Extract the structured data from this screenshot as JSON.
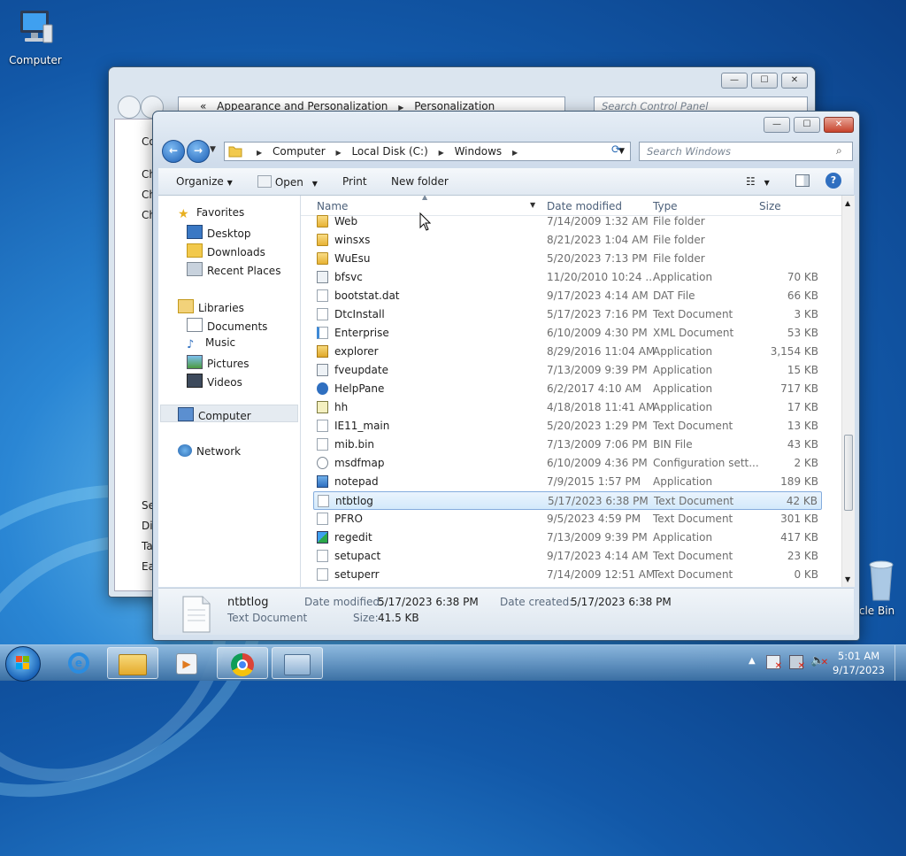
{
  "desktop": {
    "computer_label": "Computer",
    "recycle_label": "cle Bin"
  },
  "control_panel": {
    "breadcrumb_prefix": "«",
    "breadcrumb_1": "Appearance and Personalization",
    "breadcrumb_2": "Personalization",
    "search_placeholder": "Search Control Panel",
    "side_1": "Co",
    "side_2": "Ch",
    "side_3": "Ch",
    "side_4": "Ch",
    "side_5": "Se",
    "side_6": "Dis",
    "side_7": "Ta",
    "side_8": "Ea"
  },
  "explorer": {
    "breadcrumbs": [
      "Computer",
      "Local Disk (C:)",
      "Windows"
    ],
    "search_placeholder": "Search Windows",
    "toolbar": {
      "organize": "Organize",
      "open": "Open",
      "print": "Print",
      "new_folder": "New folder"
    },
    "nav": {
      "favorites": "Favorites",
      "desktop": "Desktop",
      "downloads": "Downloads",
      "recent": "Recent Places",
      "libraries": "Libraries",
      "documents": "Documents",
      "music": "Music",
      "pictures": "Pictures",
      "videos": "Videos",
      "computer": "Computer",
      "network": "Network"
    },
    "columns": {
      "name": "Name",
      "date": "Date modified",
      "type": "Type",
      "size": "Size"
    },
    "files": [
      {
        "name": "Web",
        "date": "7/14/2009 1:32 AM",
        "type": "File folder",
        "size": "",
        "kind": "folder"
      },
      {
        "name": "winsxs",
        "date": "8/21/2023 1:04 AM",
        "type": "File folder",
        "size": "",
        "kind": "folder"
      },
      {
        "name": "WuEsu",
        "date": "5/20/2023 7:13 PM",
        "type": "File folder",
        "size": "",
        "kind": "folder"
      },
      {
        "name": "bfsvc",
        "date": "11/20/2010 10:24 ...",
        "type": "Application",
        "size": "70 KB",
        "kind": "app"
      },
      {
        "name": "bootstat.dat",
        "date": "9/17/2023 4:14 AM",
        "type": "DAT File",
        "size": "66 KB",
        "kind": "doc"
      },
      {
        "name": "DtcInstall",
        "date": "5/17/2023 7:16 PM",
        "type": "Text Document",
        "size": "3 KB",
        "kind": "doc"
      },
      {
        "name": "Enterprise",
        "date": "6/10/2009 4:30 PM",
        "type": "XML Document",
        "size": "53 KB",
        "kind": "xml"
      },
      {
        "name": "explorer",
        "date": "8/29/2016 11:04 AM",
        "type": "Application",
        "size": "3,154 KB",
        "kind": "explorer"
      },
      {
        "name": "fveupdate",
        "date": "7/13/2009 9:39 PM",
        "type": "Application",
        "size": "15 KB",
        "kind": "app"
      },
      {
        "name": "HelpPane",
        "date": "6/2/2017 4:10 AM",
        "type": "Application",
        "size": "717 KB",
        "kind": "help"
      },
      {
        "name": "hh",
        "date": "4/18/2018 11:41 AM",
        "type": "Application",
        "size": "17 KB",
        "kind": "hh"
      },
      {
        "name": "IE11_main",
        "date": "5/20/2023 1:29 PM",
        "type": "Text Document",
        "size": "13 KB",
        "kind": "doc"
      },
      {
        "name": "mib.bin",
        "date": "7/13/2009 7:06 PM",
        "type": "BIN File",
        "size": "43 KB",
        "kind": "doc"
      },
      {
        "name": "msdfmap",
        "date": "6/10/2009 4:36 PM",
        "type": "Configuration sett...",
        "size": "2 KB",
        "kind": "config"
      },
      {
        "name": "notepad",
        "date": "7/9/2015 1:57 PM",
        "type": "Application",
        "size": "189 KB",
        "kind": "notepad"
      },
      {
        "name": "ntbtlog",
        "date": "5/17/2023 6:38 PM",
        "type": "Text Document",
        "size": "42 KB",
        "kind": "doc",
        "selected": true
      },
      {
        "name": "PFRO",
        "date": "9/5/2023 4:59 PM",
        "type": "Text Document",
        "size": "301 KB",
        "kind": "doc"
      },
      {
        "name": "regedit",
        "date": "7/13/2009 9:39 PM",
        "type": "Application",
        "size": "417 KB",
        "kind": "regedit"
      },
      {
        "name": "setupact",
        "date": "9/17/2023 4:14 AM",
        "type": "Text Document",
        "size": "23 KB",
        "kind": "doc"
      },
      {
        "name": "setuperr",
        "date": "7/14/2009 12:51 AM",
        "type": "Text Document",
        "size": "0 KB",
        "kind": "doc"
      }
    ],
    "details": {
      "filename": "ntbtlog",
      "filetype": "Text Document",
      "date_modified_label": "Date modified:",
      "date_modified": "5/17/2023 6:38 PM",
      "date_created_label": "Date created:",
      "date_created": "5/17/2023 6:38 PM",
      "size_label": "Size:",
      "size": "41.5 KB"
    }
  },
  "taskbar": {
    "time": "5:01 AM",
    "date": "9/17/2023"
  }
}
